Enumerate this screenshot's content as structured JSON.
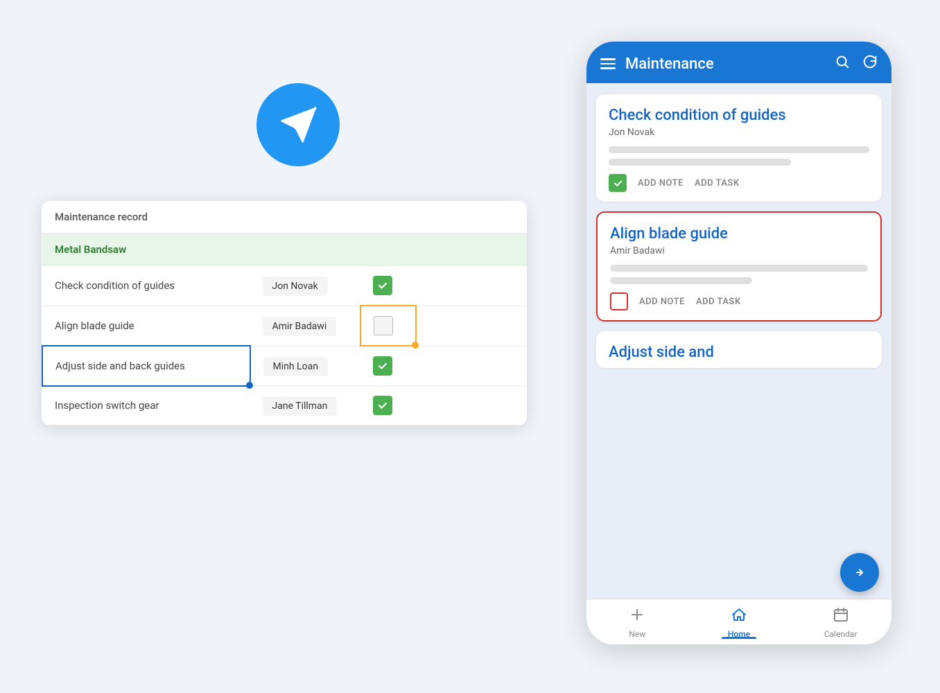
{
  "paperPlane": {
    "label": "paper-plane-icon"
  },
  "spreadsheet": {
    "headerRow": {
      "col1": "Maintenance record",
      "col2": "",
      "col3": ""
    },
    "sectionRow": {
      "label": "Metal Bandsaw"
    },
    "rows": [
      {
        "task": "Check condition of guides",
        "assignee": "Jon Novak",
        "checked": true,
        "selected": false,
        "yellowCell": false
      },
      {
        "task": "Align blade guide",
        "assignee": "Amir Badawi",
        "checked": false,
        "selected": false,
        "yellowCell": true
      },
      {
        "task": "Adjust side and back guides",
        "assignee": "Minh Loan",
        "checked": true,
        "selected": true,
        "yellowCell": false
      },
      {
        "task": "Inspection switch gear",
        "assignee": "Jane Tillman",
        "checked": true,
        "selected": false,
        "yellowCell": false
      }
    ]
  },
  "phone": {
    "header": {
      "title": "Maintenance",
      "searchLabel": "search",
      "refreshLabel": "refresh"
    },
    "cards": [
      {
        "title": "Check condition of guides",
        "assignee": "Jon Novak",
        "checked": true,
        "selected": false,
        "actions": {
          "addNote": "ADD NOTE",
          "addTask": "ADD TASK"
        }
      },
      {
        "title": "Align blade guide",
        "assignee": "Amir Badawi",
        "checked": false,
        "selected": true,
        "actions": {
          "addNote": "ADD NOTE",
          "addTask": "ADD TASK"
        }
      }
    ],
    "partialCard": {
      "title": "Adjust side and"
    },
    "nav": {
      "items": [
        {
          "label": "New",
          "icon": "plus",
          "active": false
        },
        {
          "label": "Home",
          "icon": "home",
          "active": true
        },
        {
          "label": "Calendar",
          "icon": "calendar",
          "active": false
        }
      ]
    }
  }
}
